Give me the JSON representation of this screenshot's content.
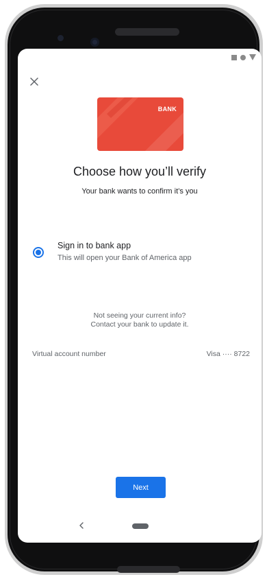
{
  "card": {
    "label": "BANK",
    "color": "#e84a3a"
  },
  "header": {
    "title": "Choose how you’ll verify",
    "subtitle": "Your bank wants to confirm it’s you"
  },
  "option": {
    "title": "Sign in to bank app",
    "description": "This will open your Bank of America app",
    "selected": true
  },
  "help": {
    "line1": "Not seeing your current info?",
    "line2": "Contact your bank to update it."
  },
  "account": {
    "label": "Virtual account number",
    "value": "Visa ···· 8722"
  },
  "actions": {
    "next_label": "Next"
  },
  "icons": {
    "close": "close-icon",
    "back": "back-chevron-icon",
    "home": "home-pill-icon"
  },
  "colors": {
    "accent": "#1a73e8"
  }
}
